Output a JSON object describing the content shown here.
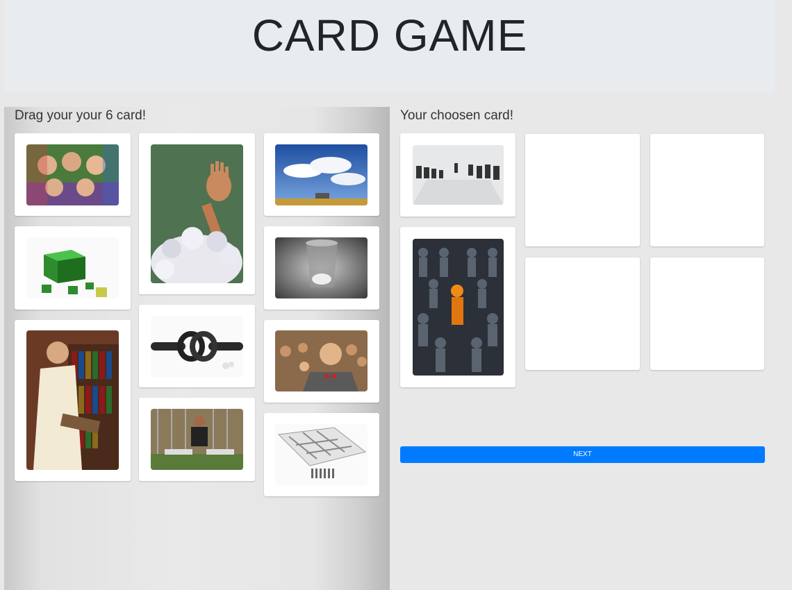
{
  "header": {
    "title": "CARD GAME"
  },
  "left_panel": {
    "title": "Drag your your 6 card!",
    "cards": [
      {
        "image": "children-faces-circle"
      },
      {
        "image": "hand-in-paper-pile"
      },
      {
        "image": "desk-under-sky"
      },
      {
        "image": "green-cubes"
      },
      {
        "image": "trash-bin"
      },
      {
        "image": "man-reading-book"
      },
      {
        "image": "rope-knot"
      },
      {
        "image": "laughing-man-bowtie"
      },
      {
        "image": "man-sitting-fence"
      },
      {
        "image": "maze-3d"
      }
    ]
  },
  "right_panel": {
    "title": "Your choosen card!",
    "chosen_cards": [
      {
        "image": "boardroom-meeting"
      },
      {
        "image": "orange-figure-in-crowd"
      }
    ],
    "empty_slots": 4
  },
  "next_button": {
    "label": "NEXT",
    "color": "#007bff"
  }
}
